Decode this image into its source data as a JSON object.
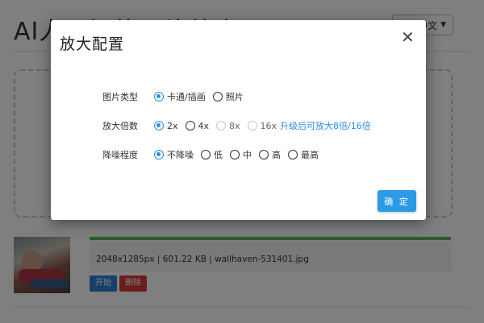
{
  "page": {
    "title": "AI人工智能图片放大",
    "language_label": "中文"
  },
  "file": {
    "info": "2048x1285px | 601.22 KB | wallhaven-531401.jpg",
    "progress": 1.0,
    "start_label": "开始",
    "delete_label": "删除"
  },
  "modal": {
    "title": "放大配置",
    "close_symbol": "✕",
    "image_type": {
      "label": "图片类型",
      "options": [
        "卡通/插画",
        "照片"
      ],
      "selected": "卡通/插画"
    },
    "scale": {
      "label": "放大倍数",
      "options": [
        "2x",
        "4x",
        "8x",
        "16x"
      ],
      "selected": "2x",
      "disabled": [
        "8x",
        "16x"
      ],
      "upgrade_text": "升级后可放大8倍/16倍"
    },
    "denoise": {
      "label": "降噪程度",
      "options": [
        "不降噪",
        "低",
        "中",
        "高",
        "最高"
      ],
      "selected": "不降噪"
    },
    "confirm_label": "确 定"
  },
  "colors": {
    "accent": "#2d8de0",
    "confirm": "#2d9ae6",
    "start_button": "#2f7fd0",
    "delete_button": "#d9383a",
    "progress": "#5cb85c"
  }
}
